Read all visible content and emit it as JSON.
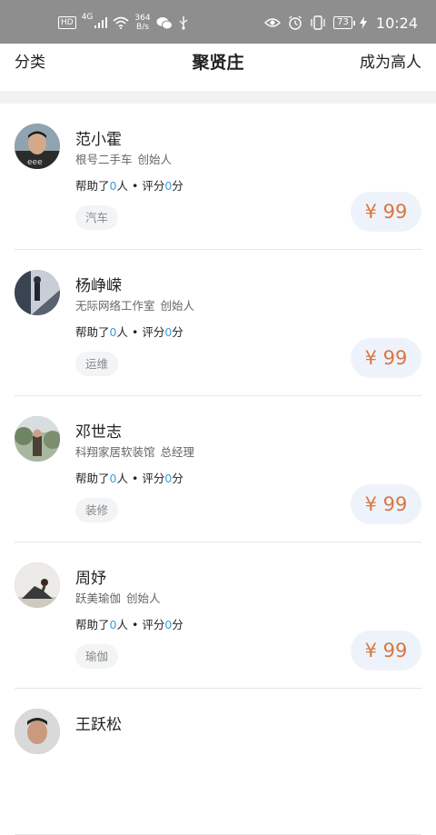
{
  "status_bar": {
    "hd": "HD",
    "network": "4G",
    "speed_value": "364",
    "speed_unit": "B/s",
    "battery": "73",
    "time": "10:24",
    "icons": [
      "signal-icon",
      "wifi-icon",
      "wechat-icon",
      "usb-icon",
      "eye-icon",
      "alarm-icon",
      "vibrate-icon",
      "charging-icon"
    ]
  },
  "header": {
    "left_label": "分类",
    "title": "聚贤庄",
    "right_label": "成为高人"
  },
  "experts": [
    {
      "name": "范小霍",
      "company": "根号二手车",
      "role": "创始人",
      "help_prefix": "帮助了",
      "help_count": "0",
      "help_unit": "人",
      "score_prefix": "评分",
      "score": "0",
      "score_unit": "分",
      "tag": "汽车",
      "price": "¥ 99"
    },
    {
      "name": "杨峥嵘",
      "company": "无际网络工作室",
      "role": "创始人",
      "help_prefix": "帮助了",
      "help_count": "0",
      "help_unit": "人",
      "score_prefix": "评分",
      "score": "0",
      "score_unit": "分",
      "tag": "运维",
      "price": "¥ 99"
    },
    {
      "name": "邓世志",
      "company": "科翔家居软装馆",
      "role": "总经理",
      "help_prefix": "帮助了",
      "help_count": "0",
      "help_unit": "人",
      "score_prefix": "评分",
      "score": "0",
      "score_unit": "分",
      "tag": "装修",
      "price": "¥ 99"
    },
    {
      "name": "周妤",
      "company": "跃美瑜伽",
      "role": "创始人",
      "help_prefix": "帮助了",
      "help_count": "0",
      "help_unit": "人",
      "score_prefix": "评分",
      "score": "0",
      "score_unit": "分",
      "tag": "瑜伽",
      "price": "¥ 99"
    },
    {
      "name": "王跃松"
    }
  ],
  "colors": {
    "status_bar_bg": "#8e8e8e",
    "accent_number": "#3aa0d8",
    "price_text": "#d9773e",
    "price_bg": "#eef3fb",
    "tag_bg": "#f3f4f6"
  }
}
